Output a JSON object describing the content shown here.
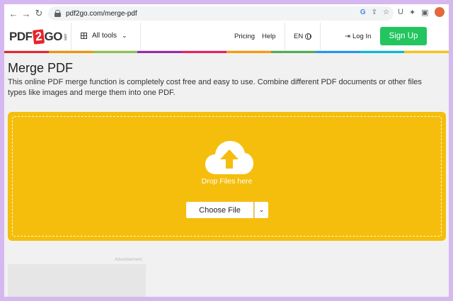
{
  "browser": {
    "url": "pdf2go.com/merge-pdf",
    "icons": [
      "back-arrow-icon",
      "forward-arrow-icon",
      "reload-icon",
      "lock-icon",
      "google-icon",
      "share-icon",
      "star-icon",
      "u-extension-icon",
      "puzzle-icon",
      "sidebar-icon",
      "profile-avatar-icon"
    ]
  },
  "header": {
    "logo": {
      "pdf": "PDF",
      "two": "2",
      "go": "GO",
      "com": ".com"
    },
    "all_tools": "All tools",
    "pricing": "Pricing",
    "help": "Help",
    "lang": "EN",
    "login": "Log In",
    "signup": "Sign Up",
    "rainbow_colors": [
      "#e8242c",
      "#f39200",
      "#8bc34a",
      "#9c27b0",
      "#e91e63",
      "#ff9800",
      "#4caf50",
      "#2196f3",
      "#00bcd4",
      "#ffc107"
    ]
  },
  "main": {
    "title": "Merge PDF",
    "description": "This online PDF merge function is completely cost free and easy to use. Combine different PDF documents or other files types like images and merge them into one PDF.",
    "drop_text": "Drop Files here",
    "choose_file": "Choose File",
    "chevron": "⌄",
    "ad_label": "Advertisement"
  },
  "colors": {
    "dropzone": "#f5be0c",
    "signup": "#22c55e",
    "frame_border": "#d6b8f0"
  }
}
